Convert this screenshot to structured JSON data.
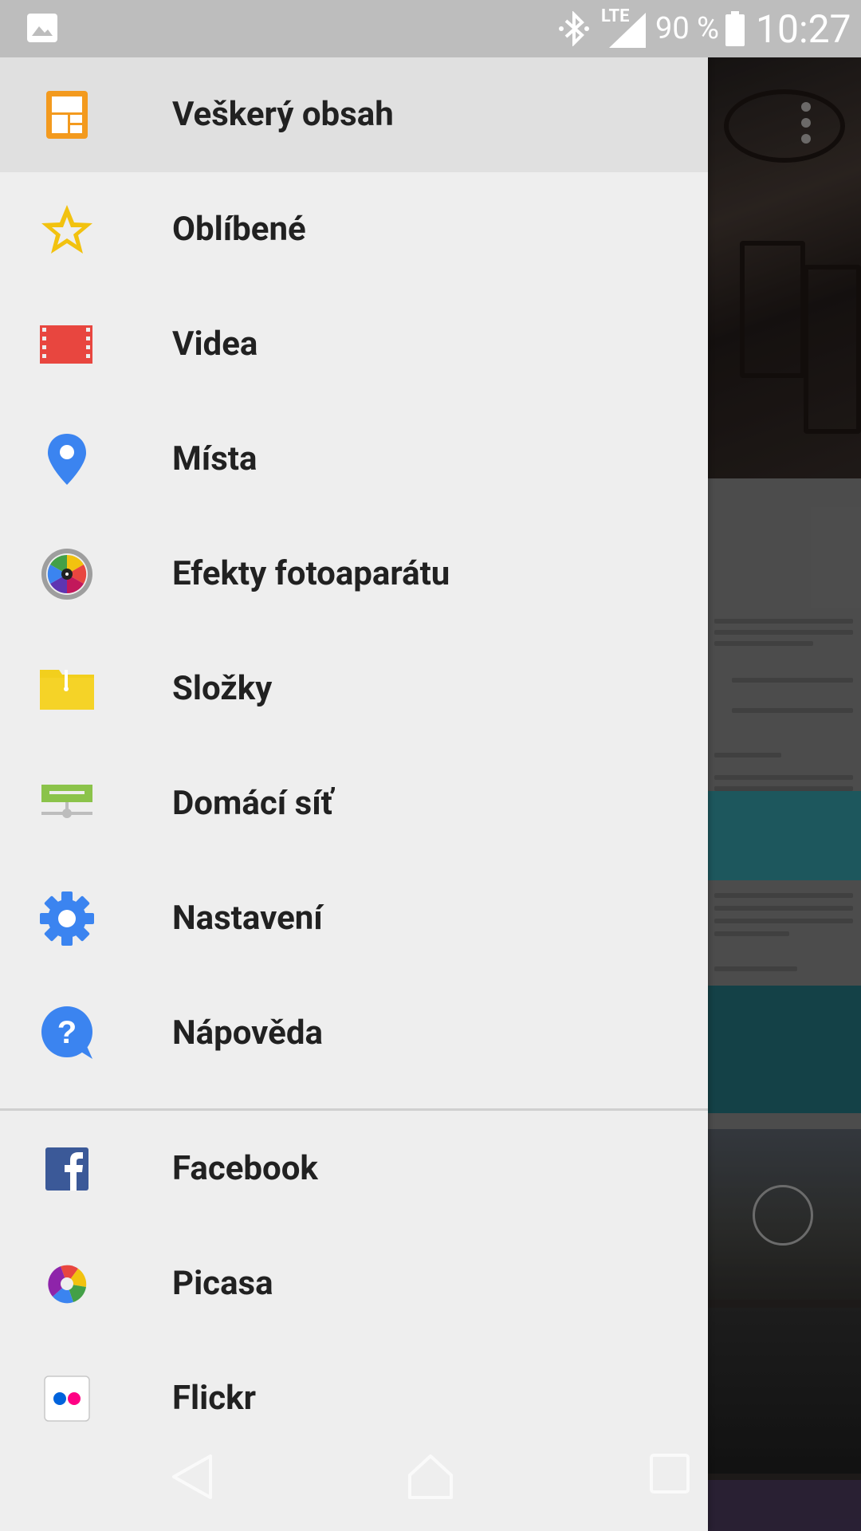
{
  "status_bar": {
    "network_type": "LTE",
    "battery_percent": "90 %",
    "time": "10:27",
    "icons": [
      "gallery-notification-icon",
      "bluetooth-icon",
      "signal-icon",
      "battery-icon"
    ]
  },
  "drawer": {
    "items": [
      {
        "label": "Veškerý obsah",
        "icon": "all-content-icon",
        "selected": true
      },
      {
        "label": "Oblíbené",
        "icon": "star-icon"
      },
      {
        "label": "Videa",
        "icon": "film-icon"
      },
      {
        "label": "Místa",
        "icon": "location-pin-icon"
      },
      {
        "label": "Efekty fotoaparátu",
        "icon": "camera-effects-icon"
      },
      {
        "label": "Složky",
        "icon": "folder-icon"
      },
      {
        "label": "Domácí síť",
        "icon": "home-network-icon"
      },
      {
        "label": "Nastavení",
        "icon": "gear-icon"
      },
      {
        "label": "Nápověda",
        "icon": "help-icon"
      }
    ],
    "services": [
      {
        "label": "Facebook",
        "icon": "facebook-icon"
      },
      {
        "label": "Picasa",
        "icon": "picasa-icon"
      },
      {
        "label": "Flickr",
        "icon": "flickr-icon"
      }
    ]
  },
  "colors": {
    "drawer_background": "#eeeeee",
    "selected_background": "#e0e0e0",
    "status_bar": "#bdbdbd",
    "text": "#212121"
  },
  "nav_bar": {
    "buttons": [
      "back-icon",
      "home-icon",
      "recents-icon"
    ]
  }
}
